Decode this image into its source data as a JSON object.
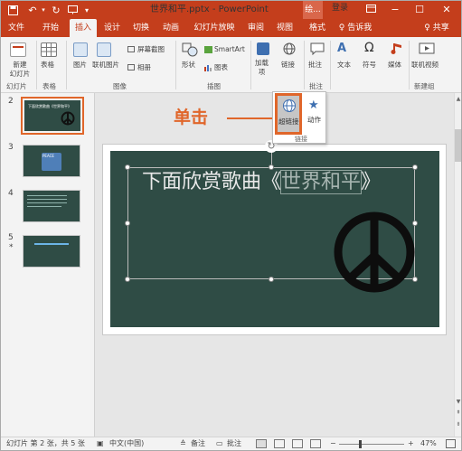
{
  "window": {
    "title": "世界和平.pptx - PowerPoint",
    "context_tab": "绘...",
    "login": "登录"
  },
  "tabs": [
    "文件",
    "开始",
    "插入",
    "设计",
    "切换",
    "动画",
    "幻灯片放映",
    "审阅",
    "视图",
    "格式",
    "♀ 告诉我",
    "♀ 共享"
  ],
  "ribbon": {
    "new_slide": "新建\n幻灯片",
    "table": "表格",
    "picture": "图片",
    "online_picture": "联机图片",
    "screenshot": "屏幕截图",
    "album": "相册",
    "shapes": "形状",
    "smartart": "SmartArt",
    "chart": "图表",
    "addins": "加载\n项",
    "links": "链接",
    "comment": "批注",
    "text": "文本",
    "symbols": "符号",
    "media": "媒体",
    "online_video": "联机视频",
    "groups": {
      "slides": "幻灯片",
      "tables": "表格",
      "images": "图像",
      "illustrations": "插图",
      "comments": "批注",
      "new_group": "新建组"
    }
  },
  "popup": {
    "hyperlink": "超链接",
    "action": "动作",
    "group": "链接"
  },
  "annotation": {
    "label": "单击"
  },
  "slides": [
    {
      "num": "2",
      "text": "下面欣赏歌曲《世界和平》"
    },
    {
      "num": "3",
      "text": "PEACE"
    },
    {
      "num": "4",
      "text": ""
    },
    {
      "num": "5",
      "star": "*",
      "text": ""
    }
  ],
  "slide_content": {
    "title_prefix": "下面欣赏歌曲《",
    "title_highlight": "世界和平",
    "title_suffix": "》"
  },
  "statusbar": {
    "slide_info": "幻灯片 第 2 张，共 5 张",
    "lang": "中文(中国)",
    "notes": "备注",
    "comments": "批注",
    "zoom": "47%"
  },
  "colors": {
    "accent": "#c43e1c",
    "slide_bg": "#2f4c45",
    "callout": "#e0662a"
  }
}
